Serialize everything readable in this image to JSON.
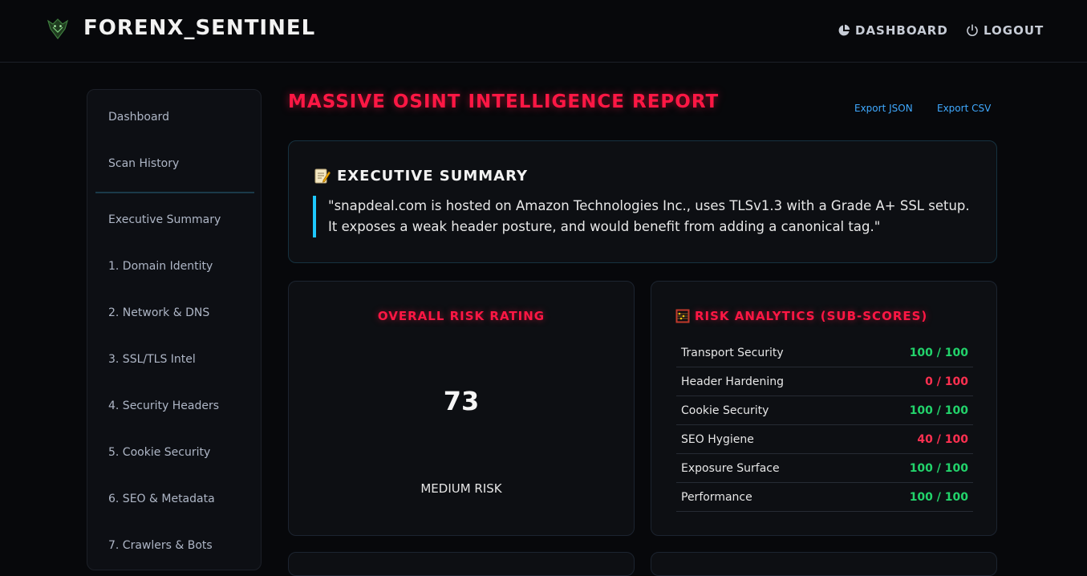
{
  "header": {
    "brand": "FORENX_SENTINEL",
    "nav": {
      "dashboard": "DASHBOARD",
      "logout": "LOGOUT"
    }
  },
  "sidebar": {
    "items": [
      "Dashboard",
      "Scan History",
      "Executive Summary",
      "1. Domain Identity",
      "2. Network & DNS",
      "3. SSL/TLS Intel",
      "4. Security Headers",
      "5. Cookie Security",
      "6. SEO & Metadata",
      "7. Crawlers & Bots"
    ]
  },
  "report": {
    "title": "MASSIVE OSINT INTELLIGENCE REPORT",
    "export_json": "Export JSON",
    "export_csv": "Export CSV"
  },
  "summary": {
    "heading": "EXECUTIVE SUMMARY",
    "text": "\"snapdeal.com is hosted on Amazon Technologies Inc., uses TLSv1.3 with a Grade A+ SSL setup. It exposes a weak header posture, and would benefit from adding a canonical tag.\""
  },
  "risk": {
    "heading": "OVERALL RISK RATING",
    "score": "73",
    "level": "MEDIUM RISK"
  },
  "analytics": {
    "heading": "RISK ANALYTICS (SUB-SCORES)",
    "rows": [
      {
        "label": "Transport Security",
        "value": "100 / 100",
        "status": "good"
      },
      {
        "label": "Header Hardening",
        "value": "0 / 100",
        "status": "bad"
      },
      {
        "label": "Cookie Security",
        "value": "100 / 100",
        "status": "good"
      },
      {
        "label": "SEO Hygiene",
        "value": "40 / 100",
        "status": "bad"
      },
      {
        "label": "Exposure Surface",
        "value": "100 / 100",
        "status": "good"
      },
      {
        "label": "Performance",
        "value": "100 / 100",
        "status": "good"
      }
    ]
  },
  "colors": {
    "accent": "#ff1744",
    "good": "#22d36b",
    "bad": "#ff3050",
    "quote_bar": "#1ec8ff",
    "link": "#3fa9ff"
  }
}
